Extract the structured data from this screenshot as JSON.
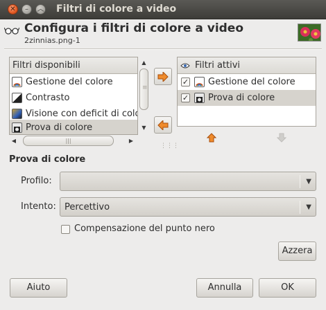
{
  "window": {
    "title": "Filtri di colore a video",
    "close_glyph": "✕",
    "minimize_glyph": "–",
    "maximize_glyph": "︿"
  },
  "header": {
    "icon": "glasses-icon",
    "title": "Configura i filtri di colore a video",
    "subtitle": "2zinnias.png-1"
  },
  "available": {
    "header": "Filtri disponibili",
    "items": [
      {
        "label": "Gestione del colore",
        "icon": "color-management-icon"
      },
      {
        "label": "Contrasto",
        "icon": "contrast-icon"
      },
      {
        "label": "Visione con deficit di colore",
        "icon": "color-deficit-icon"
      },
      {
        "label": "Prova di colore",
        "icon": "color-proof-icon"
      }
    ],
    "selected_index": 3
  },
  "active": {
    "header": "Filtri attivi",
    "header_icon": "eye-icon",
    "items": [
      {
        "label": "Gestione del colore",
        "checked": true,
        "icon": "color-management-icon"
      },
      {
        "label": "Prova di colore",
        "checked": true,
        "icon": "color-proof-icon"
      }
    ],
    "selected_index": 1
  },
  "transfer": {
    "add_icon": "arrow-right-icon",
    "remove_icon": "arrow-left-icon",
    "up_icon": "arrow-up-icon",
    "down_icon": "arrow-down-icon"
  },
  "settings": {
    "section_title": "Prova di colore",
    "profile_label": "Profilo:",
    "profile_value": "",
    "intent_label": "Intento:",
    "intent_value": "Percettivo",
    "blackpoint_label": "Compensazione del punto nero",
    "blackpoint_checked": false,
    "reset_label": "Azzera"
  },
  "buttons": {
    "help": "Aiuto",
    "cancel": "Annulla",
    "ok": "OK"
  },
  "colors": {
    "accent_orange": "#e8791e",
    "window_bg": "#edeceb",
    "titlebar": "#3d3c38",
    "selection": "#d6d3cd"
  }
}
